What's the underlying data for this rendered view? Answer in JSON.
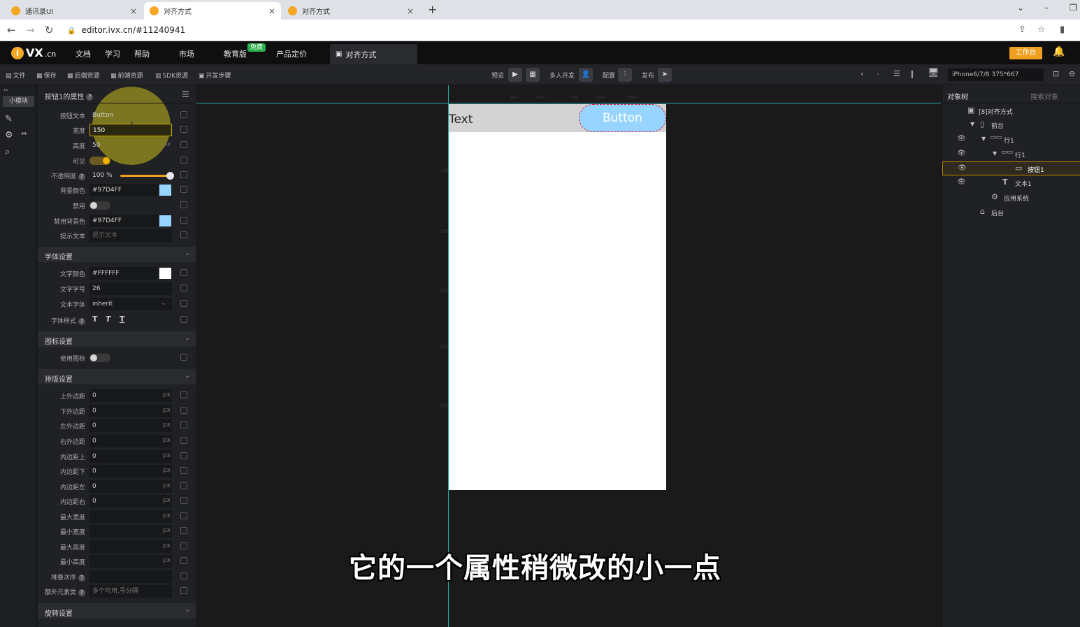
{
  "browser": {
    "tabs": [
      {
        "title": "通讯录UI",
        "close": "×"
      },
      {
        "title": "对齐方式",
        "close": "×"
      },
      {
        "title": "对齐方式",
        "close": "×"
      }
    ],
    "new_tab": "+",
    "url": "editor.ivx.cn/#11240941"
  },
  "app": {
    "logo": {
      "mark": "i",
      "name": "VX",
      "suffix": ".cn"
    },
    "menu": [
      "文档",
      "学习",
      "帮助",
      "市场",
      "教育版",
      "产品定价"
    ],
    "free_badge": "免费",
    "open_tab": "对齐方式",
    "workbench_label": "工作台"
  },
  "toolbar": {
    "left_items": [
      "文件",
      "保存",
      "后端资源",
      "前端资源",
      "SDK资源",
      "开发步骤"
    ],
    "preview_label": "预览",
    "multi_dev_label": "多人开发",
    "config_label": "配置",
    "publish_label": "发布",
    "device": "iPhone6/7/8 375*667"
  },
  "iconstrip": {
    "mini_block": "小模块"
  },
  "props": {
    "title": "按钮1的属性",
    "rows": {
      "button_text": {
        "label": "按钮文本",
        "value": "Button"
      },
      "width": {
        "label": "宽度",
        "value": "150"
      },
      "height": {
        "label": "高度",
        "value": "50",
        "unit": "px"
      },
      "visible": {
        "label": "可见",
        "value": true
      },
      "opacity": {
        "label": "不透明度",
        "value": "100",
        "unit": "%"
      },
      "bg_color": {
        "label": "背景颜色",
        "value": "#97D4FF"
      },
      "disabled": {
        "label": "禁用",
        "value": false
      },
      "disabled_bg": {
        "label": "禁用背景色",
        "value": "#97D4FF"
      },
      "hint_text": {
        "label": "提示文本",
        "placeholder": "提示文本"
      }
    },
    "font_section": "字体设置",
    "font_rows": {
      "color": {
        "label": "文字颜色",
        "value": "#FFFFFF"
      },
      "size": {
        "label": "文字字号",
        "value": "26"
      },
      "family": {
        "label": "文本字体",
        "value": "inherit"
      },
      "style": {
        "label": "字体样式",
        "buttons": [
          "T",
          "T",
          "T"
        ]
      }
    },
    "icon_section": "图标设置",
    "use_icon": {
      "label": "使用图标",
      "value": false
    },
    "layout_section": "排版设置",
    "unit_px": "px",
    "layout_rows": [
      {
        "label": "上外边距",
        "value": "0"
      },
      {
        "label": "下外边距",
        "value": "0"
      },
      {
        "label": "左外边距",
        "value": "0"
      },
      {
        "label": "右外边距",
        "value": "0"
      },
      {
        "label": "内边距上",
        "value": "0"
      },
      {
        "label": "内边距下",
        "value": "0"
      },
      {
        "label": "内边距左",
        "value": "0"
      },
      {
        "label": "内边距右",
        "value": "0"
      },
      {
        "label": "最大宽度",
        "value": ""
      },
      {
        "label": "最小宽度",
        "value": ""
      },
      {
        "label": "最大高度",
        "value": ""
      },
      {
        "label": "最小高度",
        "value": ""
      }
    ],
    "stack_order": {
      "label": "堆叠次序"
    },
    "extra_class": {
      "label": "额外元素类",
      "placeholder": "多个可用,号分隔"
    },
    "rotate_section": "旋转设置"
  },
  "canvas": {
    "ruler_top": [
      "50",
      "100",
      "150",
      "200",
      "250"
    ],
    "ruler_left": [
      "100",
      "200",
      "300",
      "400",
      "500"
    ],
    "text_label": "Text",
    "button_label": "Button",
    "subtitle": "它的一个属性稍微改的小一点"
  },
  "tree": {
    "tab_tree": "对象树",
    "tab_search": "搜索对象",
    "items": [
      {
        "label": "[8]对齐方式"
      },
      {
        "label": "前台"
      },
      {
        "label": "行1"
      },
      {
        "label": "行1"
      },
      {
        "label": "按钮1"
      },
      {
        "label": "文本1"
      },
      {
        "label": "应用系统"
      },
      {
        "label": "后台"
      }
    ]
  },
  "colors": {
    "accent": "#f0a020",
    "button_bg": "#97d4ff",
    "guide": "#2aa7a0",
    "selection": "#c48a00"
  }
}
